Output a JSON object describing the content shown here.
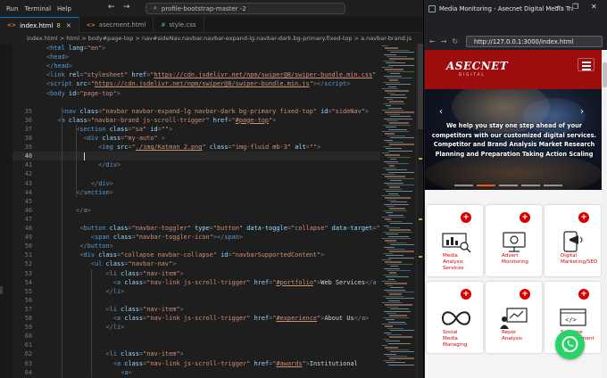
{
  "menu": [
    "Run",
    "Terminal",
    "Help"
  ],
  "command_center": "profile-bootstrap-master -2",
  "tabs": [
    {
      "label": "index.html",
      "badge": "8",
      "active": true,
      "type": "html"
    },
    {
      "label": "asecment.html",
      "active": false,
      "type": "html"
    },
    {
      "label": "style.css",
      "active": false,
      "type": "css"
    }
  ],
  "breadcrumb": "index.html > html > body#page-top > nav#sideNav.navbar.navbar-expand-lg.navbar-dark.bg-primary.fixed-top > a.navbar-brand.js",
  "code_lines": [
    {
      "n": "",
      "indent": 0,
      "t": [
        [
          "t-punct",
          "<"
        ],
        [
          "t-tag",
          "html"
        ],
        [
          "t-attr",
          " lang"
        ],
        [
          "t-punct",
          "="
        ],
        [
          "t-str",
          "\"en\""
        ],
        [
          "t-punct",
          ">"
        ]
      ]
    },
    {
      "n": "",
      "indent": 0,
      "t": [
        [
          "t-punct",
          "<"
        ],
        [
          "t-tag",
          "head"
        ],
        [
          "t-punct",
          ">"
        ]
      ]
    },
    {
      "n": "",
      "indent": 0,
      "t": [
        [
          "t-punct",
          "</"
        ],
        [
          "t-tag",
          "head"
        ],
        [
          "t-punct",
          ">"
        ]
      ]
    },
    {
      "n": "",
      "indent": 0,
      "t": [
        [
          "t-punct",
          "<"
        ],
        [
          "t-tag",
          "link"
        ],
        [
          "t-attr",
          " rel"
        ],
        [
          "t-punct",
          "="
        ],
        [
          "t-str",
          "\"stylesheet\""
        ],
        [
          "t-attr",
          " href"
        ],
        [
          "t-punct",
          "="
        ],
        [
          "t-str",
          "\""
        ],
        [
          "t-url",
          "https://cdn.jsdelivr.net/npm/swiper@8/swiper-bundle.min.css"
        ],
        [
          "t-str",
          "\""
        ],
        [
          "t-punct",
          " />"
        ]
      ]
    },
    {
      "n": "",
      "indent": 0,
      "t": [
        [
          "t-punct",
          "<"
        ],
        [
          "t-tag",
          "script"
        ],
        [
          "t-attr",
          " src"
        ],
        [
          "t-punct",
          "="
        ],
        [
          "t-str",
          "\""
        ],
        [
          "t-url",
          "https://cdn.jsdelivr.net/npm/swiper@8/swiper-bundle.min.js"
        ],
        [
          "t-str",
          "\""
        ],
        [
          "t-punct",
          "></"
        ],
        [
          "t-tag",
          "script"
        ],
        [
          "t-punct",
          ">"
        ]
      ]
    },
    {
      "n": "",
      "indent": 0,
      "t": [
        [
          "t-punct",
          "<"
        ],
        [
          "t-tag",
          "body"
        ],
        [
          "t-attr",
          " id"
        ],
        [
          "t-punct",
          "="
        ],
        [
          "t-str",
          "\"page-top\""
        ],
        [
          "t-punct",
          ">"
        ]
      ]
    },
    {
      "n": "",
      "indent": 0,
      "t": []
    },
    {
      "n": "35",
      "indent": 4,
      "t": [
        [
          "t-punct",
          "<"
        ],
        [
          "t-tag",
          "nav"
        ],
        [
          "t-attr",
          " class"
        ],
        [
          "t-punct",
          "="
        ],
        [
          "t-str",
          "\"navbar navbar-expand-lg navbar-dark bg-primary fixed-top\""
        ],
        [
          "t-attr",
          " id"
        ],
        [
          "t-punct",
          "="
        ],
        [
          "t-str",
          "\"sideNav\""
        ],
        [
          "t-punct",
          ">"
        ]
      ]
    },
    {
      "n": "36",
      "indent": 3,
      "t": [
        [
          "t-punct",
          "<"
        ],
        [
          "t-tag",
          "a"
        ],
        [
          "t-attr",
          " class"
        ],
        [
          "t-punct",
          "="
        ],
        [
          "t-str",
          "\"navbar-brand js-scroll-trigger\""
        ],
        [
          "t-attr",
          " href"
        ],
        [
          "t-punct",
          "="
        ],
        [
          "t-str",
          "\""
        ],
        [
          "t-url",
          "#page-top"
        ],
        [
          "t-str",
          "\""
        ],
        [
          "t-punct",
          ">"
        ]
      ]
    },
    {
      "n": "37",
      "indent": 8,
      "t": [
        [
          "t-punct",
          "<"
        ],
        [
          "t-tag",
          "section"
        ],
        [
          "t-attr",
          " class"
        ],
        [
          "t-punct",
          "="
        ],
        [
          "t-str",
          "\"sa\""
        ],
        [
          "t-attr",
          " id"
        ],
        [
          "t-punct",
          "="
        ],
        [
          "t-str",
          "\"\""
        ],
        [
          "t-punct",
          ">"
        ]
      ]
    },
    {
      "n": "38",
      "indent": 10,
      "t": [
        [
          "t-punct",
          "<"
        ],
        [
          "t-tag",
          "div"
        ],
        [
          "t-attr",
          " class"
        ],
        [
          "t-punct",
          "="
        ],
        [
          "t-str",
          "\"my-auto\""
        ],
        [
          "t-punct",
          " >"
        ]
      ]
    },
    {
      "n": "39",
      "indent": 14,
      "t": [
        [
          "t-punct",
          "<"
        ],
        [
          "t-tag",
          "img"
        ],
        [
          "t-attr",
          " src"
        ],
        [
          "t-punct",
          "="
        ],
        [
          "t-str",
          "\""
        ],
        [
          "t-url",
          "./img/Katman 2.png"
        ],
        [
          "t-str",
          "\""
        ],
        [
          "t-attr",
          " class"
        ],
        [
          "t-punct",
          "="
        ],
        [
          "t-str",
          "\"img-fluid mb-3\""
        ],
        [
          "t-attr",
          " alt"
        ],
        [
          "t-punct",
          "="
        ],
        [
          "t-str",
          "\"\""
        ],
        [
          "t-punct",
          ">"
        ]
      ]
    },
    {
      "n": "40",
      "indent": 10,
      "current": true,
      "t": []
    },
    {
      "n": "41",
      "indent": 14,
      "t": [
        [
          "t-punct",
          "</"
        ],
        [
          "t-tag",
          "div"
        ],
        [
          "t-punct",
          ">"
        ]
      ]
    },
    {
      "n": "42",
      "indent": 0,
      "t": []
    },
    {
      "n": "43",
      "indent": 12,
      "t": [
        [
          "t-punct",
          "</"
        ],
        [
          "t-tag",
          "div"
        ],
        [
          "t-punct",
          ">"
        ]
      ]
    },
    {
      "n": "44",
      "indent": 8,
      "t": [
        [
          "t-punct",
          "</"
        ],
        [
          "t-tag",
          "section"
        ],
        [
          "t-punct",
          ">"
        ]
      ]
    },
    {
      "n": "45",
      "indent": 0,
      "t": []
    },
    {
      "n": "46",
      "indent": 8,
      "t": [
        [
          "t-punct",
          "</"
        ],
        [
          "t-tag",
          "a"
        ],
        [
          "t-punct",
          ">"
        ]
      ]
    },
    {
      "n": "47",
      "indent": 0,
      "t": []
    },
    {
      "n": "48",
      "indent": 9,
      "t": [
        [
          "t-punct",
          "<"
        ],
        [
          "t-tag",
          "button"
        ],
        [
          "t-attr",
          " class"
        ],
        [
          "t-punct",
          "="
        ],
        [
          "t-str",
          "\"navbar-toggler\""
        ],
        [
          "t-attr",
          " type"
        ],
        [
          "t-punct",
          "="
        ],
        [
          "t-str",
          "\"button\""
        ],
        [
          "t-attr",
          " data-toggle"
        ],
        [
          "t-punct",
          "="
        ],
        [
          "t-str",
          "\"collapse\""
        ],
        [
          "t-attr",
          " data-target"
        ],
        [
          "t-punct",
          "="
        ],
        [
          "t-str",
          "\"#n"
        ]
      ]
    },
    {
      "n": "49",
      "indent": 12,
      "t": [
        [
          "t-punct",
          "<"
        ],
        [
          "t-tag",
          "span"
        ],
        [
          "t-attr",
          " class"
        ],
        [
          "t-punct",
          "="
        ],
        [
          "t-str",
          "\"navbar-toggler-icon\""
        ],
        [
          "t-punct",
          "></"
        ],
        [
          "t-tag",
          "span"
        ],
        [
          "t-punct",
          ">"
        ]
      ]
    },
    {
      "n": "50",
      "indent": 9,
      "t": [
        [
          "t-punct",
          "</"
        ],
        [
          "t-tag",
          "button"
        ],
        [
          "t-punct",
          ">"
        ]
      ]
    },
    {
      "n": "51",
      "indent": 9,
      "t": [
        [
          "t-punct",
          "<"
        ],
        [
          "t-tag",
          "div"
        ],
        [
          "t-attr",
          " class"
        ],
        [
          "t-punct",
          "="
        ],
        [
          "t-str",
          "\"collapse navbar-collapse\""
        ],
        [
          "t-attr",
          " id"
        ],
        [
          "t-punct",
          "="
        ],
        [
          "t-str",
          "\"navbarSupportedContent\""
        ],
        [
          "t-punct",
          ">"
        ]
      ]
    },
    {
      "n": "52",
      "indent": 12,
      "t": [
        [
          "t-punct",
          "<"
        ],
        [
          "t-tag",
          "ul"
        ],
        [
          "t-attr",
          " class"
        ],
        [
          "t-punct",
          "="
        ],
        [
          "t-str",
          "\"navbar-nav\""
        ],
        [
          "t-punct",
          ">"
        ]
      ]
    },
    {
      "n": "53",
      "indent": 16,
      "t": [
        [
          "t-punct",
          "<"
        ],
        [
          "t-tag",
          "li"
        ],
        [
          "t-attr",
          " class"
        ],
        [
          "t-punct",
          "="
        ],
        [
          "t-str",
          "\"nav-item\""
        ],
        [
          "t-punct",
          ">"
        ]
      ]
    },
    {
      "n": "54",
      "indent": 18,
      "t": [
        [
          "t-punct",
          "<"
        ],
        [
          "t-tag",
          "a"
        ],
        [
          "t-attr",
          " class"
        ],
        [
          "t-punct",
          "="
        ],
        [
          "t-str",
          "\"nav-link js-scroll-trigger\""
        ],
        [
          "t-attr",
          " href"
        ],
        [
          "t-punct",
          "="
        ],
        [
          "t-str",
          "\""
        ],
        [
          "t-url",
          "#portfolio"
        ],
        [
          "t-str",
          "\""
        ],
        [
          "t-punct",
          ">"
        ],
        [
          "t-text",
          "Web Services"
        ],
        [
          "t-punct",
          "</"
        ],
        [
          "t-tag",
          "a"
        ]
      ]
    },
    {
      "n": "55",
      "indent": 16,
      "t": [
        [
          "t-punct",
          "</"
        ],
        [
          "t-tag",
          "li"
        ],
        [
          "t-punct",
          ">"
        ]
      ]
    },
    {
      "n": "56",
      "indent": 0,
      "t": []
    },
    {
      "n": "57",
      "indent": 16,
      "t": [
        [
          "t-punct",
          "<"
        ],
        [
          "t-tag",
          "li"
        ],
        [
          "t-attr",
          " class"
        ],
        [
          "t-punct",
          "="
        ],
        [
          "t-str",
          "\"nav-item\""
        ],
        [
          "t-punct",
          ">"
        ]
      ]
    },
    {
      "n": "58",
      "indent": 18,
      "t": [
        [
          "t-punct",
          "<"
        ],
        [
          "t-tag",
          "a"
        ],
        [
          "t-attr",
          " class"
        ],
        [
          "t-punct",
          "="
        ],
        [
          "t-str",
          "\"nav-link js-scroll-trigger\""
        ],
        [
          "t-attr",
          " href"
        ],
        [
          "t-punct",
          "="
        ],
        [
          "t-str",
          "\""
        ],
        [
          "t-url",
          "#experience"
        ],
        [
          "t-str",
          "\""
        ],
        [
          "t-punct",
          ">"
        ],
        [
          "t-text",
          "About Us"
        ],
        [
          "t-punct",
          "</"
        ],
        [
          "t-tag",
          "a"
        ],
        [
          "t-punct",
          ">"
        ]
      ]
    },
    {
      "n": "59",
      "indent": 16,
      "t": [
        [
          "t-punct",
          "</"
        ],
        [
          "t-tag",
          "li"
        ],
        [
          "t-punct",
          ">"
        ]
      ]
    },
    {
      "n": "60",
      "indent": 0,
      "t": []
    },
    {
      "n": "61",
      "indent": 0,
      "t": []
    },
    {
      "n": "62",
      "indent": 16,
      "t": [
        [
          "t-punct",
          "<"
        ],
        [
          "t-tag",
          "li"
        ],
        [
          "t-attr",
          " class"
        ],
        [
          "t-punct",
          "="
        ],
        [
          "t-str",
          "\"nav-item\""
        ],
        [
          "t-punct",
          ">"
        ]
      ]
    },
    {
      "n": "63",
      "indent": 18,
      "t": [
        [
          "t-punct",
          "<"
        ],
        [
          "t-tag",
          "a"
        ],
        [
          "t-attr",
          " class"
        ],
        [
          "t-punct",
          "="
        ],
        [
          "t-str",
          "\"nav-link js-scroll-trigger\""
        ],
        [
          "t-attr",
          " href"
        ],
        [
          "t-punct",
          "="
        ],
        [
          "t-str",
          "\""
        ],
        [
          "t-url",
          "#awards"
        ],
        [
          "t-str",
          "\""
        ],
        [
          "t-punct",
          ">"
        ],
        [
          "t-text",
          "Institutional"
        ]
      ]
    },
    {
      "n": "64",
      "indent": 20,
      "t": [
        [
          "t-punct",
          "<"
        ],
        [
          "t-tag",
          "a"
        ],
        [
          "t-punct",
          ">"
        ]
      ]
    }
  ],
  "browser": {
    "title": "Media Monitoring - Asecnet Digital Media Tracking",
    "url": "http://127.0.0.1:3000/index.html"
  },
  "site": {
    "logo": "ASECNET",
    "logo_sub": "DIGITAL",
    "hero_text": "We help you stay one step ahead of your competitors with our customized digital services. Competitor and Brand Analysis Market Research Planning and Preparation Taking Action Scaling",
    "services": [
      {
        "label": "Media\nAnalysis\nServices",
        "icon": "media-analysis-icon"
      },
      {
        "label": "Advert\nMonitoring",
        "icon": "advert-monitoring-icon"
      },
      {
        "label": "Digital\nMarketing/SEO",
        "icon": "digital-marketing-icon"
      },
      {
        "label": "Social\nMedia\nManaging",
        "icon": "social-media-icon"
      },
      {
        "label": "Repor\nAnalysis",
        "icon": "report-analysis-icon"
      },
      {
        "label": "Software\nDevelopment",
        "icon": "software-icon"
      }
    ]
  },
  "colors": {
    "brand": "#9e0d0d",
    "accent": "#d50000",
    "whatsapp": "#25d366"
  }
}
